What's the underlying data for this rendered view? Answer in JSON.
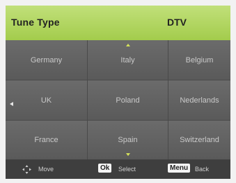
{
  "header": {
    "title": "Tune Type",
    "value": "DTV"
  },
  "countries": [
    [
      "Germany",
      "Italy",
      "Belgium"
    ],
    [
      "UK",
      "Poland",
      "Nederlands"
    ],
    [
      "France",
      "Spain",
      "Switzerland"
    ]
  ],
  "footer": {
    "move_label": "Move",
    "ok_key": "Ok",
    "select_label": "Select",
    "menu_key": "Menu",
    "back_label": "Back"
  },
  "colors": {
    "header_green": "#a3cc4c",
    "panel_gray": "#5c5c5c",
    "footer_dark": "#3e3e3e",
    "arrow_yellow": "#d6e35a"
  },
  "icons": [
    "scroll-up-arrow-icon",
    "scroll-down-arrow-icon",
    "left-arrow-icon",
    "move-icon"
  ]
}
